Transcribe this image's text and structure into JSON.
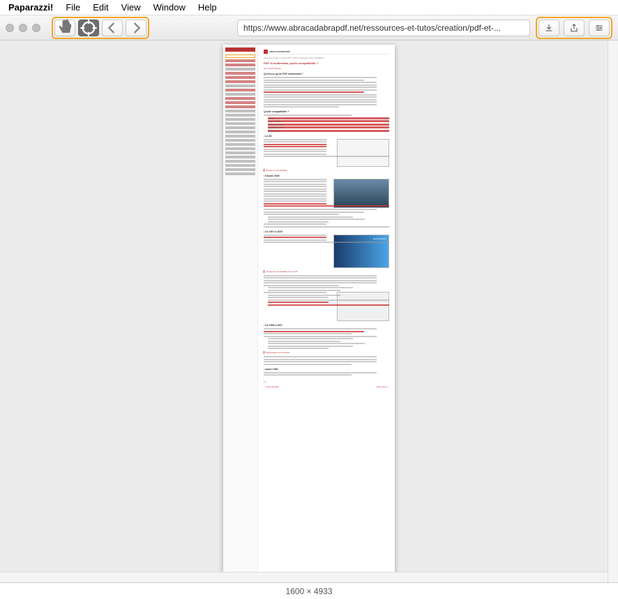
{
  "menubar": {
    "app": "Paparazzi!",
    "items": [
      "File",
      "Edit",
      "View",
      "Window",
      "Help"
    ]
  },
  "toolbar": {
    "url": "https://www.abracadabrapdf.net/ressources-et-tutos/creation/pdf-et-...",
    "hand_icon": "hand-icon",
    "target_icon": "crosshair-icon",
    "back_icon": "chevron-left-icon",
    "fwd_icon": "chevron-right-icon",
    "download_icon": "download-icon",
    "share_icon": "share-icon",
    "settings_icon": "sliders-icon"
  },
  "page": {
    "site": "ABRACADABRAPDF",
    "breadcrumb": "Ressources & tutos > Création PDF > PDF et multimédia, quelle compatibilité ?",
    "title": "PDF et multimédia, quelle compatibilité ?",
    "author": "par Vincent Bouda",
    "h_intro": "Qu'est-ce qu'un PDF multimédia ?",
    "h_compat": "Quelle compatibilité ?",
    "compat_list": [
      "- La 3D",
      "- depuis 2020",
      "- de 2007 à 2020",
      "- de 1996 à 2007",
      "- avant 1996"
    ],
    "h_3d": "• La 3D",
    "h_2020": "• Depuis 2020",
    "h_2007": "• De 2007 à 2020",
    "h_1996": "• De 1996 à 2007",
    "h_avant": "• Avant 1996",
    "tag1": "Niveau de compatibilité",
    "tag2": "Niveau de compatibilité pour la 3D",
    "tag3": "Particularités de PortFolio",
    "badge_name": "David Gilmour",
    "nav_prev": "← Article précédent",
    "nav_next": "Article suivant →"
  },
  "statusbar": {
    "dims": "1600 × 4933"
  }
}
